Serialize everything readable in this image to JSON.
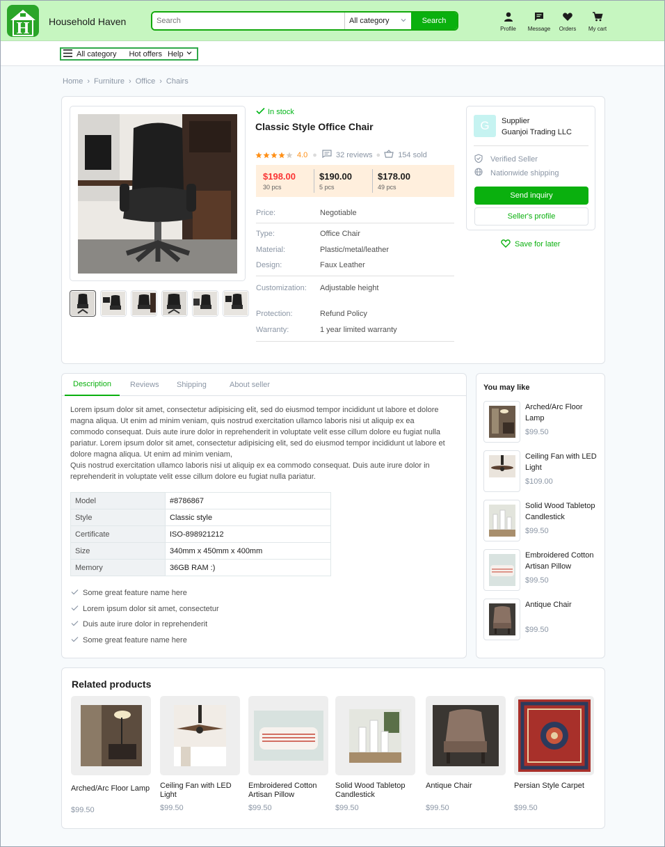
{
  "header": {
    "brand": "Household Haven",
    "search_placeholder": "Search",
    "category": "All category",
    "search_button": "Search",
    "icons": [
      {
        "label": "Profile",
        "icon": "person-icon"
      },
      {
        "label": "Message",
        "icon": "message-icon"
      },
      {
        "label": "Orders",
        "icon": "heart-icon"
      },
      {
        "label": "My cart",
        "icon": "cart-icon"
      }
    ]
  },
  "subnav": {
    "all_category": "All category",
    "hot_offers": "Hot offers",
    "help": "Help"
  },
  "breadcrumb": [
    "Home",
    "Furniture",
    "Office",
    "Chairs"
  ],
  "product": {
    "stock": "In stock",
    "title": "Classic Style Office Chair",
    "rating": "4.0",
    "rating_value": 4,
    "reviews": "32 reviews",
    "sold": "154 sold",
    "prices": [
      {
        "price": "$198.00",
        "qty": "30 pcs"
      },
      {
        "price": "$190.00",
        "qty": "5 pcs"
      },
      {
        "price": "$178.00",
        "qty": "49 pcs"
      }
    ],
    "specs": [
      {
        "k": "Price:",
        "v": "Negotiable"
      },
      {
        "k": "Type:",
        "v": "Office Chair"
      },
      {
        "k": "Material:",
        "v": "Plastic/metal/leather"
      },
      {
        "k": "Design:",
        "v": "Faux Leather"
      },
      {
        "k": "Customization:",
        "v": "Adjustable height"
      },
      {
        "k": "Protection:",
        "v": "Refund Policy"
      },
      {
        "k": "Warranty:",
        "v": "1 year limited warranty"
      }
    ]
  },
  "supplier": {
    "initial": "G",
    "label": "Supplier",
    "name": "Guanjoi Trading LLC",
    "verified": "Verified Seller",
    "shipping": "Nationwide shipping",
    "inquiry": "Send inquiry",
    "profile": "Seller's profile",
    "save": "Save for later"
  },
  "tabs": [
    "Description",
    "Reviews",
    "Shipping",
    "About seller"
  ],
  "description": {
    "p1": "Lorem ipsum dolor sit amet, consectetur adipisicing elit, sed do eiusmod tempor incididunt ut labore et dolore magna aliqua. Ut enim ad minim veniam, quis nostrud exercitation ullamco laboris nisi ut aliquip ex ea commodo consequat. Duis aute irure dolor in reprehenderit in voluptate velit esse cillum dolore eu fugiat nulla pariatur.  Lorem ipsum dolor sit amet, consectetur adipisicing elit, sed do eiusmod tempor incididunt ut labore et dolore magna aliqua. Ut enim ad minim veniam,",
    "p2": "Quis nostrud exercitation ullamco laboris nisi ut aliquip ex ea commodo consequat. Duis aute irure dolor in reprehenderit in voluptate velit esse cillum dolore eu fugiat nulla pariatur.",
    "table": [
      {
        "k": "Model",
        "v": "#8786867"
      },
      {
        "k": "Style",
        "v": "Classic style"
      },
      {
        "k": "Certificate",
        "v": "ISO-898921212"
      },
      {
        "k": "Size",
        "v": "340mm x 450mm x 400mm"
      },
      {
        "k": "Memory",
        "v": "36GB RAM :)"
      }
    ],
    "features": [
      "Some great feature name here",
      "Lorem ipsum dolor sit amet, consectetur",
      "Duis aute irure dolor in reprehenderit",
      "Some great feature name here"
    ]
  },
  "you_may_like": {
    "title": "You may like",
    "items": [
      {
        "name": "Arched/Arc Floor Lamp",
        "price": "$99.50"
      },
      {
        "name": "Ceiling Fan with LED Light",
        "price": "$109.00"
      },
      {
        "name": "Solid Wood Tabletop Candlestick",
        "price": "$99.50"
      },
      {
        "name": "Embroidered Cotton Artisan Pillow",
        "price": "$99.50"
      },
      {
        "name": "Antique Chair",
        "price": "$99.50"
      }
    ]
  },
  "related": {
    "title": "Related products",
    "items": [
      {
        "name": "Arched/Arc Floor Lamp",
        "price": "$99.50"
      },
      {
        "name": "Ceiling Fan with LED Light",
        "price": "$99.50"
      },
      {
        "name": "Embroidered Cotton Artisan Pillow",
        "price": "$99.50"
      },
      {
        "name": "Solid Wood Tabletop Candlestick",
        "price": "$99.50"
      },
      {
        "name": "Antique Chair",
        "price": "$99.50"
      },
      {
        "name": "Persian Style Carpet",
        "price": "$99.50"
      }
    ]
  },
  "colors": {
    "brand_green": "#0ab00e",
    "header_bg": "#c6f6c0",
    "price_red": "#fa3434",
    "star": "#ff9017"
  }
}
